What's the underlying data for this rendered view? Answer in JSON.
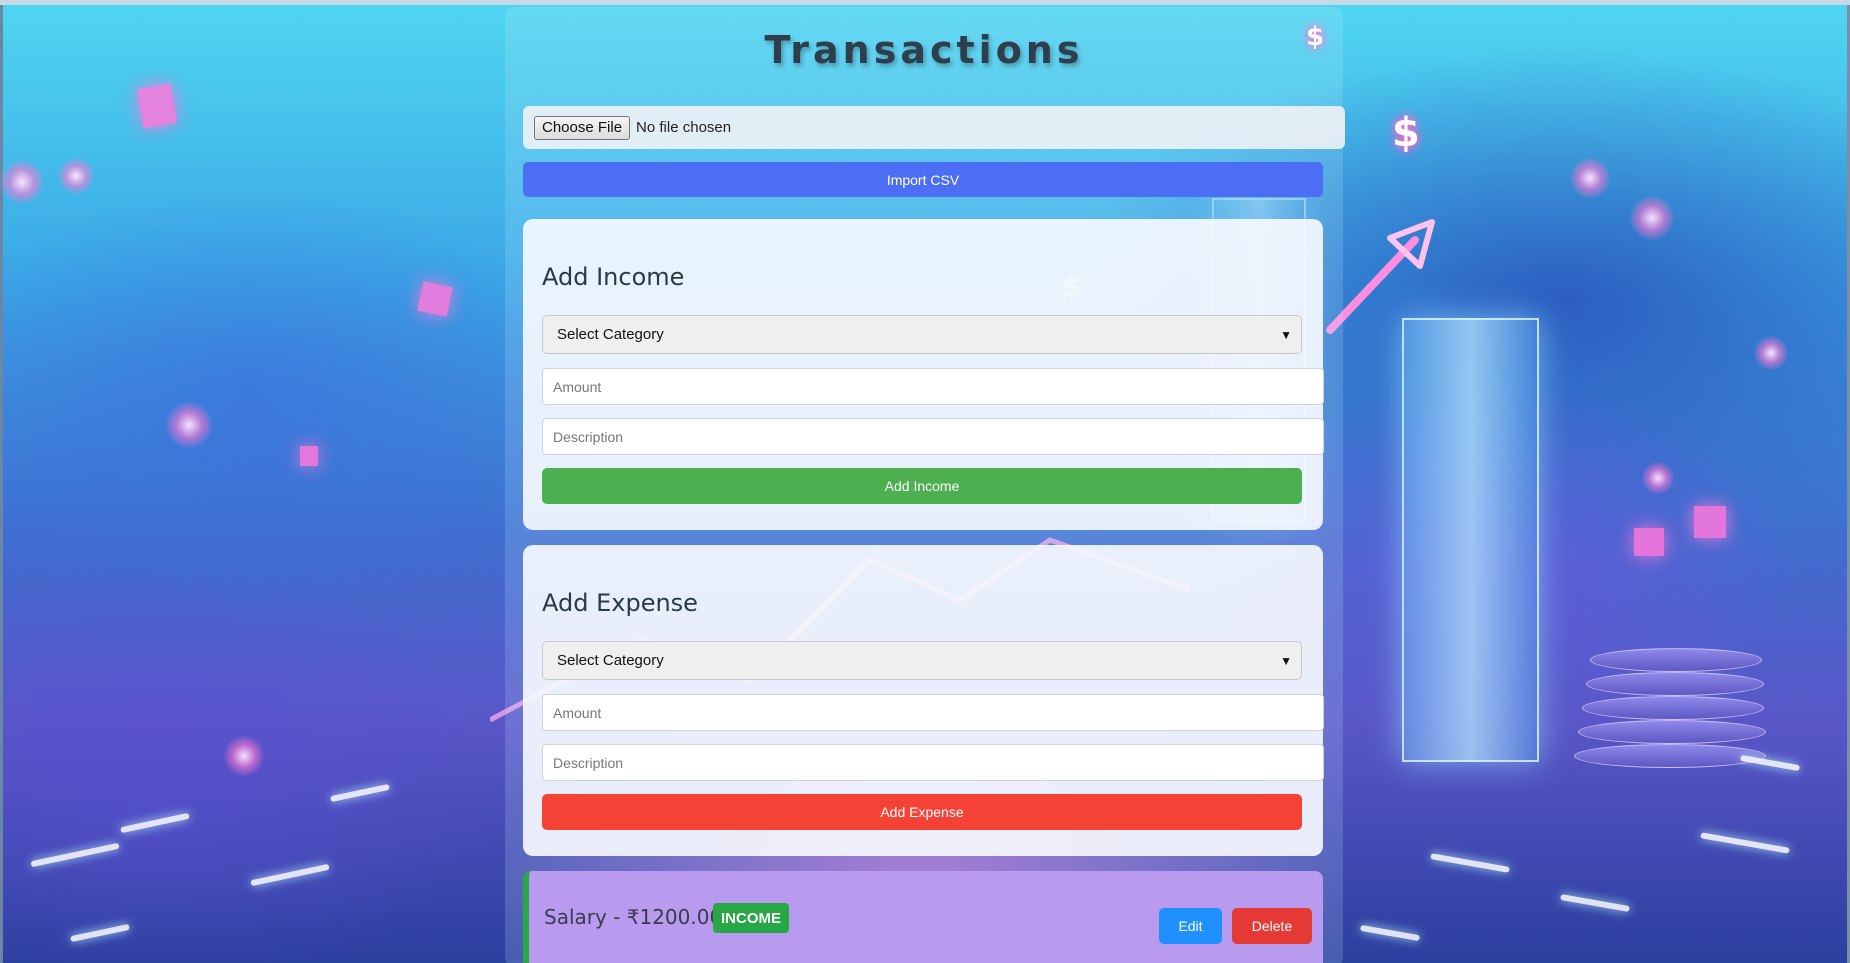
{
  "header": {
    "title": "Transactions"
  },
  "file_input": {
    "button_label": "Choose File",
    "status": "No file chosen"
  },
  "import": {
    "label": "Import CSV"
  },
  "income_form": {
    "heading": "Add Income",
    "category_value": "Select Category",
    "amount_placeholder": "Amount",
    "description_placeholder": "Description",
    "submit_label": "Add Income"
  },
  "expense_form": {
    "heading": "Add Expense",
    "category_value": "Select Category",
    "amount_placeholder": "Amount",
    "description_placeholder": "Description",
    "submit_label": "Add Expense"
  },
  "transactions": [
    {
      "text": "Salary - ₹1200.00",
      "badge": "INCOME",
      "edit_label": "Edit",
      "delete_label": "Delete"
    }
  ],
  "decor": {
    "dollar_symbol": "$"
  },
  "colors": {
    "import_button": "#4c6ef5",
    "income_button": "#4caf50",
    "expense_button": "#f44336",
    "income_badge": "#28a745",
    "edit_button": "#1e90ff",
    "delete_button": "#e53935",
    "transaction_bg": "#b89bee"
  }
}
